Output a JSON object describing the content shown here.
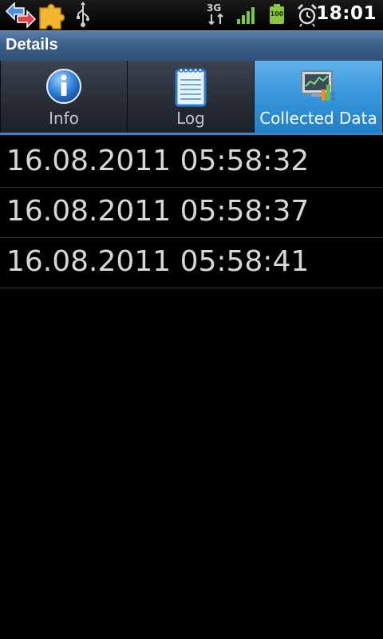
{
  "status_bar": {
    "time": "18:01",
    "network_type": "3G",
    "battery_level": "100",
    "icons": [
      "sync-arrows-icon",
      "puzzle-icon",
      "usb-icon",
      "3g-data-icon",
      "signal-icon",
      "battery-icon",
      "alarm-icon"
    ]
  },
  "title_bar": {
    "title": "Details"
  },
  "tabs": [
    {
      "label": "Info",
      "icon": "info-icon",
      "selected": false
    },
    {
      "label": "Log",
      "icon": "notepad-icon",
      "selected": false
    },
    {
      "label": "Collected Data",
      "icon": "chart-monitor-icon",
      "selected": true
    }
  ],
  "list": {
    "items": [
      {
        "text": "16.08.2011 05:58:32"
      },
      {
        "text": "16.08.2011 05:58:37"
      },
      {
        "text": "16.08.2011 05:58:41"
      }
    ]
  },
  "colors": {
    "selected_tab": "#3a98dc",
    "title_bar": "#3d5f8a",
    "signal": "#7ac943",
    "battery": "#8cc63f"
  }
}
